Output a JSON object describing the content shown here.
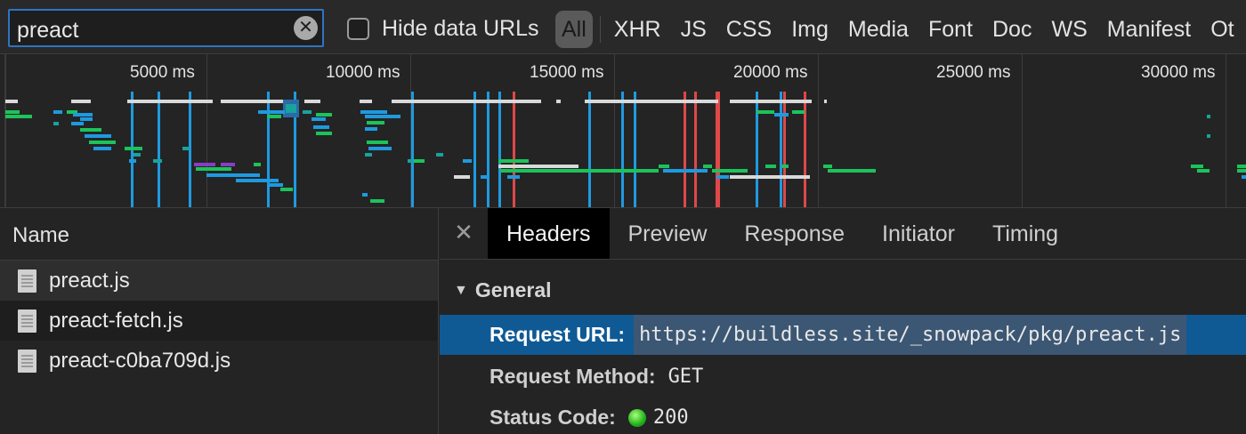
{
  "filter_bar": {
    "search_value": "preact",
    "clear_icon": "close-circle-icon",
    "hide_data_urls_label": "Hide data URLs",
    "hide_data_urls_checked": false,
    "types": [
      "All",
      "XHR",
      "JS",
      "CSS",
      "Img",
      "Media",
      "Font",
      "Doc",
      "WS",
      "Manifest",
      "Ot"
    ],
    "active_type": "All"
  },
  "overview": {
    "ticks": [
      "5000 ms",
      "10000 ms",
      "15000 ms",
      "20000 ms",
      "25000 ms",
      "30000 ms"
    ],
    "colors": {
      "bar_gray": "#d9d9d9",
      "bar_blue": "#1e9ae0",
      "bar_green": "#1cc35a",
      "bar_purple": "#8a3bc8",
      "bar_cyan": "#18a39d",
      "dom_content_loaded_line": "#1e9ae0",
      "load_line": "#e04848"
    }
  },
  "requests": {
    "column_header": "Name",
    "items": [
      {
        "name": "preact.js",
        "icon": "file-document-icon"
      },
      {
        "name": "preact-fetch.js",
        "icon": "file-document-icon"
      },
      {
        "name": "preact-c0ba709d.js",
        "icon": "file-document-icon"
      }
    ],
    "selected_index": 0
  },
  "details": {
    "close_icon": "close-icon",
    "tabs": [
      "Headers",
      "Preview",
      "Response",
      "Initiator",
      "Timing"
    ],
    "active_tab": "Headers",
    "section": "General",
    "section_icon": "triangle-down-icon",
    "rows": [
      {
        "key": "Request URL:",
        "value": "https://buildless.site/_snowpack/pkg/preact.js"
      },
      {
        "key": "Request Method:",
        "value": "GET"
      },
      {
        "key": "Status Code:",
        "value": "200",
        "status_icon": "status-green-dot-icon",
        "status_color": "#21b11c"
      }
    ]
  }
}
